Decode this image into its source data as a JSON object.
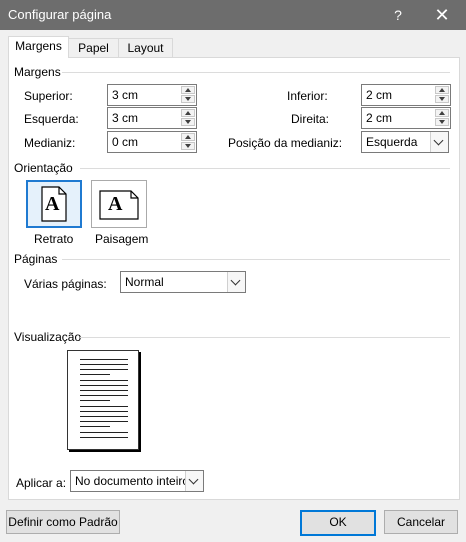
{
  "window": {
    "title": "Configurar página",
    "help_label": "?",
    "close_label": "✕"
  },
  "tabs": [
    {
      "label": "Margens",
      "active": true
    },
    {
      "label": "Papel",
      "active": false
    },
    {
      "label": "Layout",
      "active": false
    }
  ],
  "margens": {
    "section_title": "Margens",
    "superior": {
      "label": "Superior:",
      "value": "3 cm"
    },
    "esquerda": {
      "label": "Esquerda:",
      "value": "3 cm"
    },
    "medianiz": {
      "label": "Medianiz:",
      "value": "0 cm"
    },
    "inferior": {
      "label": "Inferior:",
      "value": "2 cm"
    },
    "direita": {
      "label": "Direita:",
      "value": "2 cm"
    },
    "posicao_medianiz": {
      "label": "Posição da medianiz:",
      "value": "Esquerda"
    }
  },
  "orientacao": {
    "section_title": "Orientação",
    "retrato_label": "Retrato",
    "paisagem_label": "Paisagem",
    "icon_letter": "A",
    "selected": "Retrato"
  },
  "paginas": {
    "section_title": "Páginas",
    "varias_label": "Várias páginas:",
    "varias_value": "Normal"
  },
  "visualizacao": {
    "section_title": "Visualização",
    "aplicar_label": "Aplicar a:",
    "aplicar_value": "No documento inteiro"
  },
  "footer": {
    "default_label": "Definir como Padrão",
    "ok_label": "OK",
    "cancel_label": "Cancelar"
  },
  "colors": {
    "titlebar": "#6d6d6d",
    "accent": "#0078d7"
  }
}
